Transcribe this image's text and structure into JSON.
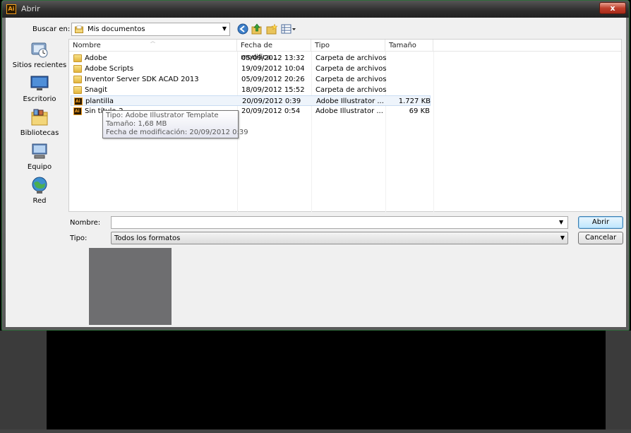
{
  "window": {
    "title": "Abrir",
    "app_icon_text": "Ai",
    "close_glyph": "x"
  },
  "toolbar": {
    "lookin_label": "Buscar en:",
    "lookin_value": "Mis documentos"
  },
  "places": [
    {
      "label": "Sitios recientes",
      "icon": "recent-places-icon"
    },
    {
      "label": "Escritorio",
      "icon": "desktop-icon"
    },
    {
      "label": "Bibliotecas",
      "icon": "libraries-icon"
    },
    {
      "label": "Equipo",
      "icon": "computer-icon"
    },
    {
      "label": "Red",
      "icon": "network-icon"
    }
  ],
  "columns": {
    "name": "Nombre",
    "date": "Fecha de modifica...",
    "type": "Tipo",
    "size": "Tamaño"
  },
  "files": [
    {
      "name": "Adobe",
      "date": "05/09/2012 13:32",
      "type": "Carpeta de archivos",
      "size": "",
      "kind": "folder"
    },
    {
      "name": "Adobe Scripts",
      "date": "19/09/2012 10:04",
      "type": "Carpeta de archivos",
      "size": "",
      "kind": "folder"
    },
    {
      "name": "Inventor Server SDK ACAD 2013",
      "date": "05/09/2012 20:26",
      "type": "Carpeta de archivos",
      "size": "",
      "kind": "folder"
    },
    {
      "name": "Snagit",
      "date": "18/09/2012 15:52",
      "type": "Carpeta de archivos",
      "size": "",
      "kind": "folder"
    },
    {
      "name": "plantilla",
      "date": "20/09/2012 0:39",
      "type": "Adobe Illustrator ...",
      "size": "1.727 KB",
      "kind": "ai"
    },
    {
      "name": "Sin título-2",
      "date": "20/09/2012 0:54",
      "type": "Adobe Illustrator ...",
      "size": "69 KB",
      "kind": "ai"
    }
  ],
  "tooltip": {
    "type_line": "Tipo: Adobe Illustrator Template",
    "size_line": "Tamaño: 1,68 MB",
    "date_line": "Fecha de modificación: 20/09/2012 0:39"
  },
  "form": {
    "name_label": "Nombre:",
    "name_value": "",
    "type_label": "Tipo:",
    "type_value": "Todos los formatos",
    "open_label": "Abrir",
    "cancel_label": "Cancelar"
  },
  "colors": {
    "accent_orange": "#f29d1e",
    "close_red": "#c0402c",
    "hover_blue": "#eef4fb"
  }
}
